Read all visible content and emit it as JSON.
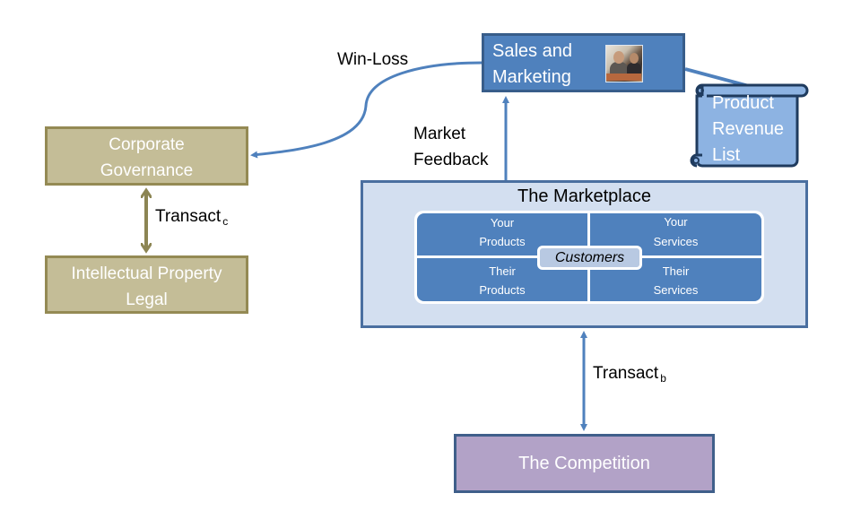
{
  "diagram": {
    "nodes": {
      "sales_marketing": {
        "label_line1": "Sales and",
        "label_line2": "Marketing",
        "icon": "business-meeting-photo",
        "color": "#4f81bd"
      },
      "product_revenue_list": {
        "label_line1": "Product",
        "label_line2": "Revenue",
        "label_line3": "List",
        "shape": "scroll",
        "color": "#8db3e2"
      },
      "corporate_governance": {
        "label_line1": "Corporate",
        "label_line2": "Governance",
        "color": "#c4bd97"
      },
      "ip_legal": {
        "label_line1": "Intellectual Property",
        "label_line2": "Legal",
        "color": "#c4bd97"
      },
      "marketplace": {
        "title": "The Marketplace",
        "color": "#d3dff0",
        "quadrants": [
          {
            "line1": "Your",
            "line2": "Products"
          },
          {
            "line1": "Your",
            "line2": "Services"
          },
          {
            "line1": "Their",
            "line2": "Products"
          },
          {
            "line1": "Their",
            "line2": "Services"
          }
        ],
        "center": "Customers"
      },
      "competition": {
        "label": "The Competition",
        "color": "#b2a2c7"
      }
    },
    "edges": {
      "win_loss": {
        "label": "Win-Loss",
        "from": "Sales and Marketing",
        "to": "Corporate Governance"
      },
      "market_feedback": {
        "label_line1": "Market",
        "label_line2": "Feedback",
        "from": "The Marketplace",
        "to": "Sales and Marketing"
      },
      "transact_c": {
        "label": "Transact",
        "subscript": "c",
        "between": [
          "Corporate Governance",
          "Intellectual Property Legal"
        ]
      },
      "transact_b": {
        "label": "Transact",
        "subscript": "b",
        "between": [
          "The Marketplace",
          "The Competition"
        ]
      },
      "sales_to_list": {
        "from": "Sales and Marketing",
        "to": "Product Revenue List"
      }
    },
    "colors": {
      "connector_blue": "#4f81bd",
      "connector_olive": "#8c8553"
    }
  }
}
